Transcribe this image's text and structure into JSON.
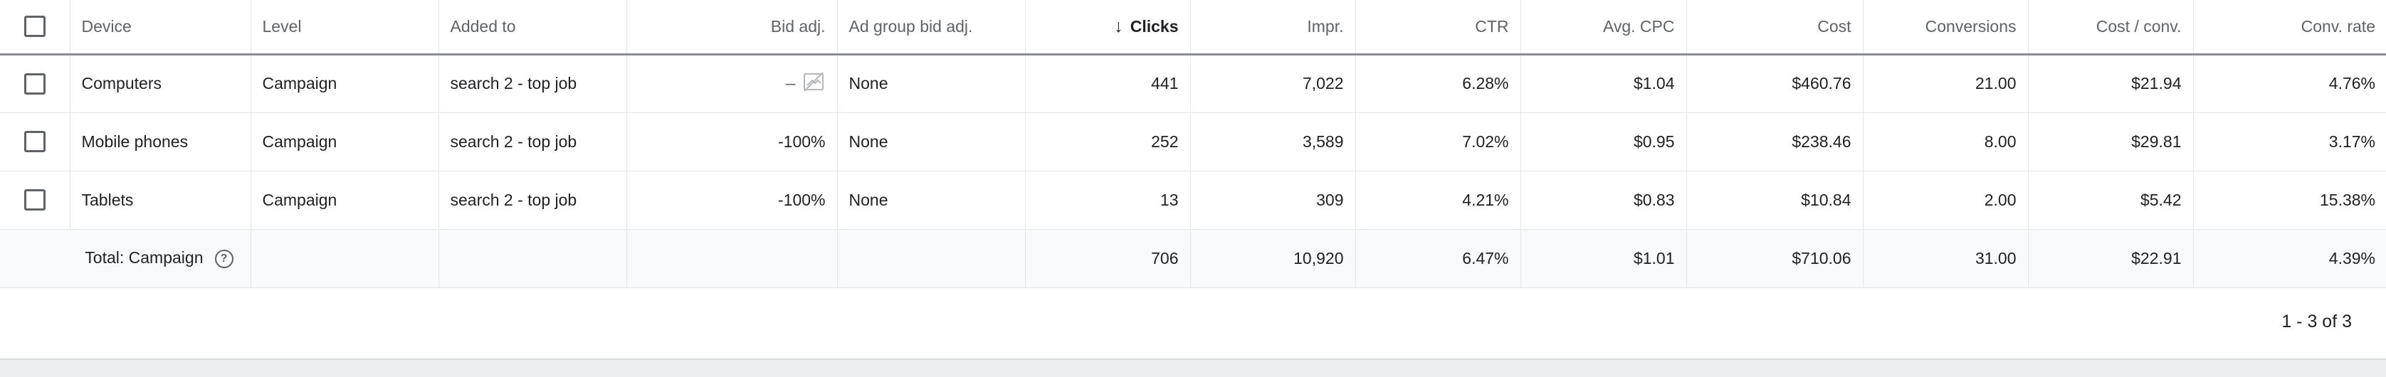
{
  "table": {
    "columns": [
      {
        "key": "device",
        "label": "Device"
      },
      {
        "key": "level",
        "label": "Level"
      },
      {
        "key": "added_to",
        "label": "Added to"
      },
      {
        "key": "bid_adj",
        "label": "Bid adj."
      },
      {
        "key": "ad_group_bid_adj",
        "label": "Ad group bid adj."
      },
      {
        "key": "clicks",
        "label": "Clicks",
        "sorted": "descending"
      },
      {
        "key": "impr",
        "label": "Impr."
      },
      {
        "key": "ctr",
        "label": "CTR"
      },
      {
        "key": "avg_cpc",
        "label": "Avg. CPC"
      },
      {
        "key": "cost",
        "label": "Cost"
      },
      {
        "key": "conversions",
        "label": "Conversions"
      },
      {
        "key": "cost_per_conv",
        "label": "Cost / conv."
      },
      {
        "key": "conv_rate",
        "label": "Conv. rate"
      }
    ],
    "rows": [
      {
        "device": "Computers",
        "level": "Campaign",
        "added_to": "search 2 - top job",
        "bid_adj": "–",
        "bid_adj_icon": "edit-disabled-icon",
        "ad_group_bid_adj": "None",
        "clicks": "441",
        "impr": "7,022",
        "ctr": "6.28%",
        "avg_cpc": "$1.04",
        "cost": "$460.76",
        "conversions": "21.00",
        "cost_per_conv": "$21.94",
        "conv_rate": "4.76%"
      },
      {
        "device": "Mobile phones",
        "level": "Campaign",
        "added_to": "search 2 - top job",
        "bid_adj": "-100%",
        "ad_group_bid_adj": "None",
        "clicks": "252",
        "impr": "3,589",
        "ctr": "7.02%",
        "avg_cpc": "$0.95",
        "cost": "$238.46",
        "conversions": "8.00",
        "cost_per_conv": "$29.81",
        "conv_rate": "3.17%"
      },
      {
        "device": "Tablets",
        "level": "Campaign",
        "added_to": "search 2 - top job",
        "bid_adj": "-100%",
        "ad_group_bid_adj": "None",
        "clicks": "13",
        "impr": "309",
        "ctr": "4.21%",
        "avg_cpc": "$0.83",
        "cost": "$10.84",
        "conversions": "2.00",
        "cost_per_conv": "$5.42",
        "conv_rate": "15.38%"
      }
    ],
    "total": {
      "label": "Total: Campaign",
      "clicks": "706",
      "impr": "10,920",
      "ctr": "6.47%",
      "avg_cpc": "$1.01",
      "cost": "$710.06",
      "conversions": "31.00",
      "cost_per_conv": "$22.91",
      "conv_rate": "4.39%"
    }
  },
  "pagination": {
    "text": "1 - 3 of 3"
  },
  "icons": {
    "sort": "arrow-down-icon",
    "help": "help-circle-icon"
  },
  "colors": {
    "header_text": "#5f6368",
    "text": "#202124",
    "border": "#e3e5e8",
    "total_bg": "#f8f9fa"
  }
}
